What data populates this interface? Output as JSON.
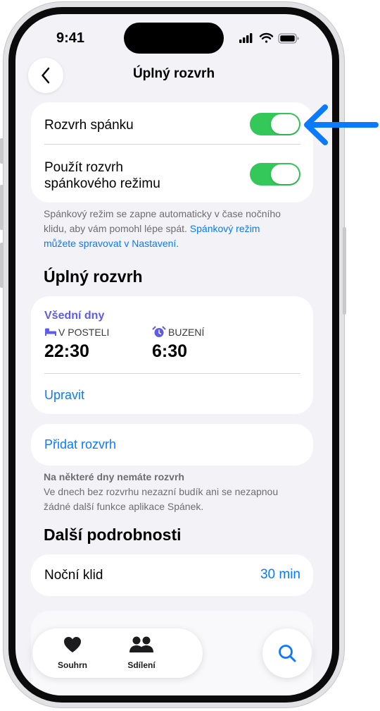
{
  "status_bar": {
    "time": "9:41"
  },
  "nav": {
    "title": "Úplný rozvrh"
  },
  "settings": {
    "sleep_schedule_label": "Rozvrh spánku",
    "sleep_focus_label_line1": "Použít rozvrh",
    "sleep_focus_label_line2": "spánkového režimu",
    "toggles": {
      "sleep_schedule": true,
      "sleep_focus": true
    },
    "footnote_line1": "Spánkový režim se zapne automaticky v čase nočního",
    "footnote_line2_plain": "klidu, aby vám pomohl lépe spát.",
    "footnote_line2_link": "Spánkový režim",
    "footnote_line3_link": "můžete spravovat v Nastavení."
  },
  "full_schedule": {
    "section_title": "Úplný rozvrh",
    "weekdays_label": "Všední dny",
    "bedtime_label": "V POSTELI",
    "bedtime_value": "22:30",
    "wake_label": "BUZENÍ",
    "wake_value": "6:30",
    "edit_label": "Upravit",
    "add_schedule_label": "Přidat rozvrh",
    "no_schedule_title": "Na některé dny nemáte rozvrh",
    "no_schedule_line1": "Ve dnech bez rozvrhu nezazní budík ani se nezapnou",
    "no_schedule_line2": "žádné další funkce aplikace Spánek."
  },
  "more_details": {
    "section_title": "Další podrobnosti",
    "wind_down_label": "Noční klid",
    "wind_down_value": "30 min"
  },
  "tab_bar": {
    "tabs": [
      {
        "label": "Souhrn",
        "icon": "heart-icon"
      },
      {
        "label": "Sdílení",
        "icon": "people-icon"
      }
    ],
    "search_icon": "search-icon"
  },
  "colors": {
    "accent": "#0a7aff",
    "toggle_on": "#34c759",
    "weekdays_purple": "#5e5ce6",
    "background": "#f2f2f7",
    "callout_arrow": "#0a7aff"
  }
}
